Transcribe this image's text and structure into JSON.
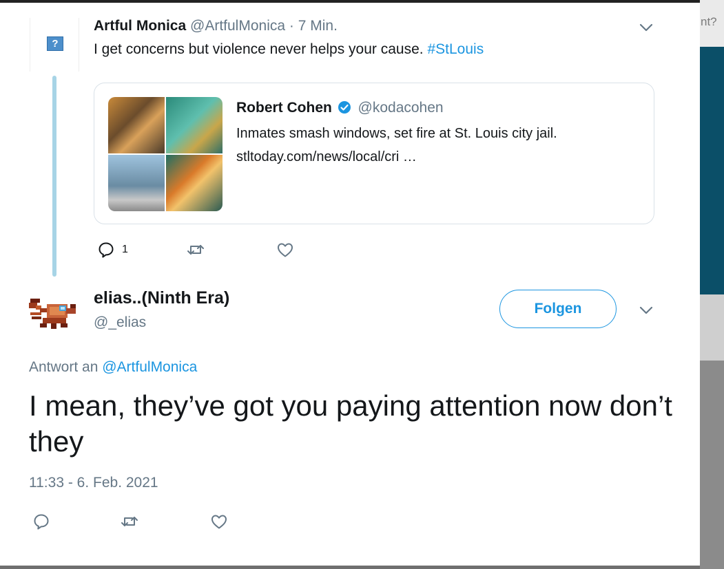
{
  "background": {
    "partial_text": "nt?"
  },
  "parent_tweet": {
    "avatar_placeholder": "?",
    "name": "Artful Monica",
    "handle": "@ArtfulMonica",
    "separator": "·",
    "time": "7 Min.",
    "text": "I get concerns but violence never helps your cause.",
    "hashtag": "#StLouis",
    "quote": {
      "name": "Robert Cohen",
      "verified": true,
      "handle": "@kodacohen",
      "text": "Inmates smash windows, set fire at St. Louis city jail.",
      "url": "stltoday.com/news/local/cri …"
    },
    "reply_count": "1"
  },
  "main_tweet": {
    "name": "elias..(Ninth Era)",
    "handle": "@_elias",
    "follow_label": "Folgen",
    "reply_prefix": "Antwort an",
    "reply_to": "@ArtfulMonica",
    "text": "I mean, they’ve got you paying attention now don’t they",
    "timestamp": "11:33 - 6. Feb. 2021"
  },
  "colors": {
    "link": "#1b95e0",
    "muted": "#657786",
    "thread_line": "#a7d4e6",
    "text": "#14171a"
  },
  "icons": [
    "chevron-down-icon",
    "verified-badge-icon",
    "reply-icon",
    "retweet-icon",
    "like-icon"
  ]
}
